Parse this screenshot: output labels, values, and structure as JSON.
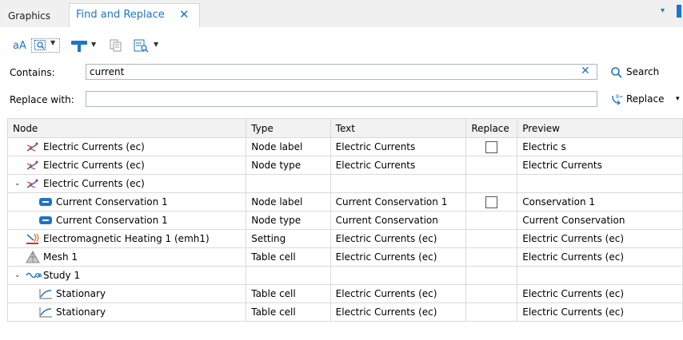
{
  "tabs": [
    {
      "label": "Graphics",
      "active": false
    },
    {
      "label": "Find and Replace",
      "active": true,
      "close_glyph": "✕"
    }
  ],
  "tab_menu_glyph": "▾",
  "toolbar": {
    "match_case_label": "aA",
    "icons": [
      "find-mode-icon",
      "hammer-icon",
      "copy-icon",
      "list-icon"
    ]
  },
  "contains": {
    "label": "Contains:",
    "value": "current",
    "clear_glyph": "✕"
  },
  "search_button": {
    "label": "Search"
  },
  "replace_with": {
    "label": "Replace with:",
    "value": ""
  },
  "replace_button": {
    "label": "Replace",
    "dropdown_glyph": "▾"
  },
  "colors": {
    "accent": "#1e74c8",
    "tab_bg": "#f0f0f0",
    "header_bg": "#f2f2f2",
    "grid": "#dadada"
  },
  "table": {
    "columns": [
      "Node",
      "Type",
      "Text",
      "Replace",
      "Preview"
    ],
    "rows": [
      {
        "indent": 1,
        "expander": "",
        "icon": "electric-currents-icon",
        "node": "Electric Currents (ec)",
        "type": "Node label",
        "text": "Electric Currents",
        "checkbox": true,
        "preview": "Electric s"
      },
      {
        "indent": 1,
        "expander": "",
        "icon": "electric-currents-icon",
        "node": "Electric Currents (ec)",
        "type": "Node type",
        "text": "Electric Currents",
        "checkbox": false,
        "preview": "Electric Currents"
      },
      {
        "indent": 0,
        "expander": "⌄",
        "icon": "electric-currents-icon",
        "node": "Electric Currents (ec)",
        "type": "",
        "text": "",
        "checkbox": false,
        "preview": ""
      },
      {
        "indent": 2,
        "expander": "",
        "icon": "current-conservation-icon",
        "node": "Current Conservation 1",
        "type": "Node label",
        "text": "Current Conservation 1",
        "checkbox": true,
        "preview": " Conservation 1"
      },
      {
        "indent": 2,
        "expander": "",
        "icon": "current-conservation-icon",
        "node": "Current Conservation 1",
        "type": "Node type",
        "text": "Current Conservation",
        "checkbox": false,
        "preview": "Current Conservation"
      },
      {
        "indent": 1,
        "expander": "",
        "icon": "electromagnetic-heating-icon",
        "node": "Electromagnetic Heating 1 (emh1)",
        "type": "Setting",
        "text": "Electric Currents (ec)",
        "checkbox": false,
        "preview": "Electric Currents (ec)"
      },
      {
        "indent": 1,
        "expander": "",
        "icon": "mesh-icon",
        "node": "Mesh 1",
        "type": "Table cell",
        "text": "Electric Currents (ec)",
        "checkbox": false,
        "preview": "Electric Currents (ec)"
      },
      {
        "indent": 0,
        "expander": "⌄",
        "icon": "study-icon",
        "node": "Study 1",
        "type": "",
        "text": "",
        "checkbox": false,
        "preview": ""
      },
      {
        "indent": 2,
        "expander": "",
        "icon": "stationary-icon",
        "node": "Stationary",
        "type": "Table cell",
        "text": "Electric Currents (ec)",
        "checkbox": false,
        "preview": "Electric Currents (ec)"
      },
      {
        "indent": 2,
        "expander": "",
        "icon": "stationary-icon",
        "node": "Stationary",
        "type": "Table cell",
        "text": "Electric Currents (ec)",
        "checkbox": false,
        "preview": "Electric Currents (ec)"
      }
    ]
  }
}
